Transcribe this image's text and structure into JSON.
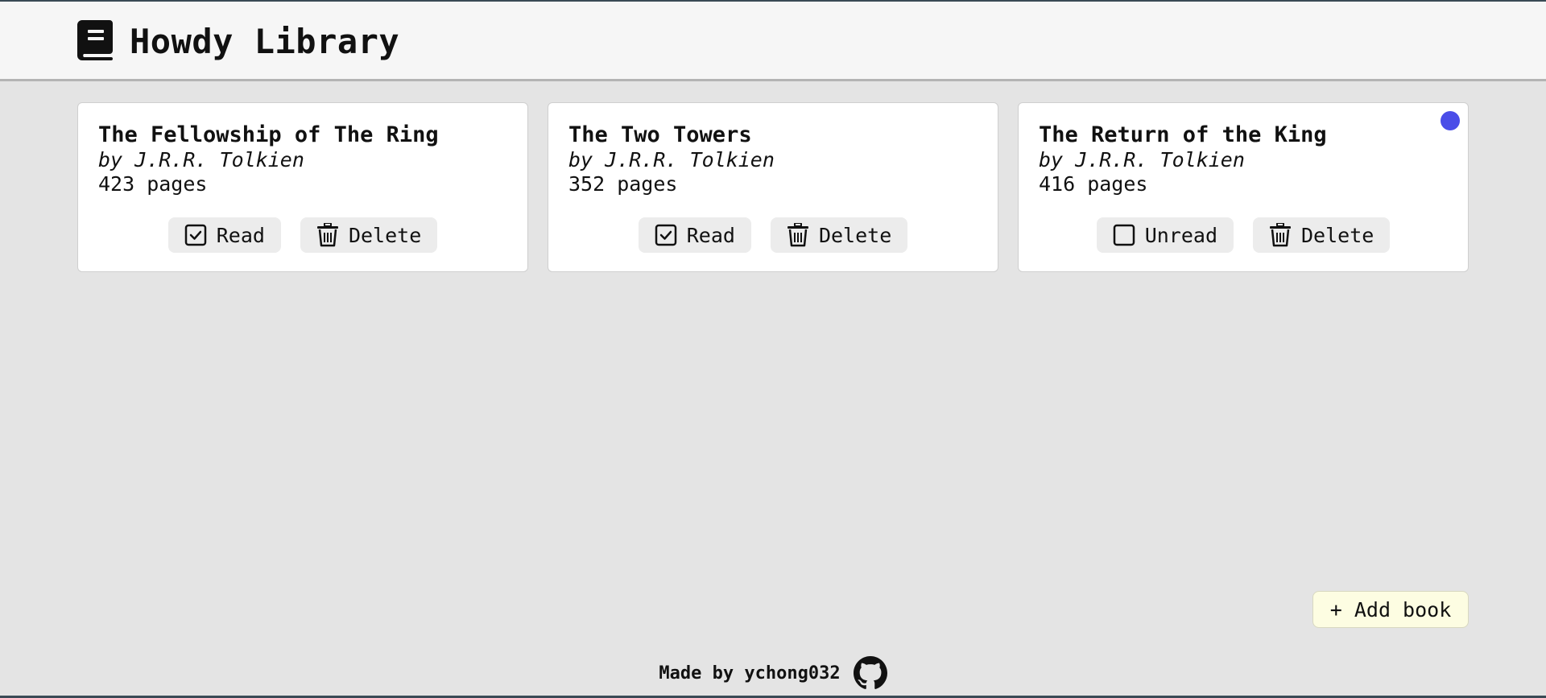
{
  "header": {
    "title": "Howdy Library",
    "logo_icon": "book-icon"
  },
  "books": [
    {
      "title": "The Fellowship of The Ring",
      "author": "by J.R.R. Tolkien",
      "pages": "423 pages",
      "status_label": "Read",
      "status_icon": "checked-checkbox-icon",
      "delete_label": "Delete",
      "delete_icon": "trash-icon",
      "selected": false
    },
    {
      "title": "The Two Towers",
      "author": "by J.R.R. Tolkien",
      "pages": "352 pages",
      "status_label": "Read",
      "status_icon": "checked-checkbox-icon",
      "delete_label": "Delete",
      "delete_icon": "trash-icon",
      "selected": false
    },
    {
      "title": "The Return of the King",
      "author": "by J.R.R. Tolkien",
      "pages": "416 pages",
      "status_label": "Unread",
      "status_icon": "empty-checkbox-icon",
      "delete_label": "Delete",
      "delete_icon": "trash-icon",
      "selected": true
    }
  ],
  "add_button": {
    "label": "+ Add book"
  },
  "footer": {
    "text": "Made by ychong032",
    "icon": "github-icon"
  },
  "colors": {
    "background": "#e4e4e4",
    "header": "#f6f6f6",
    "card": "#ffffff",
    "button": "#ececec",
    "add_button": "#fdfde2",
    "indicator_dot": "#4a4de8"
  }
}
